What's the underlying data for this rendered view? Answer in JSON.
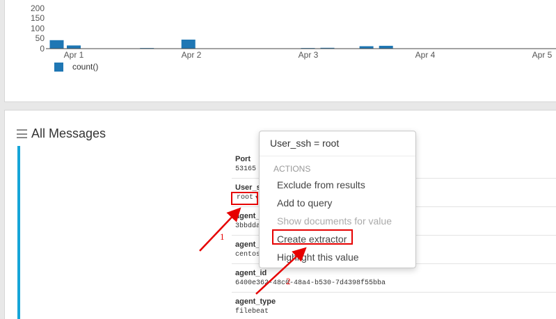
{
  "histogram": {
    "y_ticks": [
      "200",
      "150",
      "100",
      "50",
      "0"
    ],
    "x_ticks": [
      "Apr 1",
      "Apr 2",
      "Apr 3",
      "Apr 4",
      "Apr 5"
    ],
    "legend": "count()",
    "bar_color": "#1f77b4",
    "chart_data": {
      "type": "bar",
      "x_unit": "hours since Apr 1 00:00",
      "x": [
        -3.5,
        0,
        15,
        23.5,
        48,
        52,
        60,
        64
      ],
      "values": [
        42,
        16,
        3,
        45,
        3,
        4,
        12,
        14
      ],
      "ylim": [
        0,
        200
      ],
      "xlabel": "",
      "ylabel": ""
    }
  },
  "messages": {
    "title": "All Messages",
    "fields": [
      {
        "name": "Port",
        "value": "53165"
      },
      {
        "name": "User_ssh",
        "value": "root"
      },
      {
        "name": "agent_hostname",
        "value": "3bbdda"
      },
      {
        "name": "agent_name",
        "value": "centos"
      },
      {
        "name": "agent_id",
        "value": "6400e362-48c0-48a4-b530-7d4398f55bba"
      },
      {
        "name": "agent_type",
        "value": "filebeat"
      }
    ]
  },
  "popover": {
    "title": "User_ssh = root",
    "header": "ACTIONS",
    "items": [
      {
        "label": "Exclude from results",
        "enabled": true
      },
      {
        "label": "Add to query",
        "enabled": true
      },
      {
        "label": "Show documents for value",
        "enabled": false
      },
      {
        "label": "Create extractor",
        "enabled": true
      },
      {
        "label": "Highlight this value",
        "enabled": true
      }
    ]
  },
  "annotations": {
    "step1": "1",
    "step2": "2",
    "color": "#e60000"
  }
}
